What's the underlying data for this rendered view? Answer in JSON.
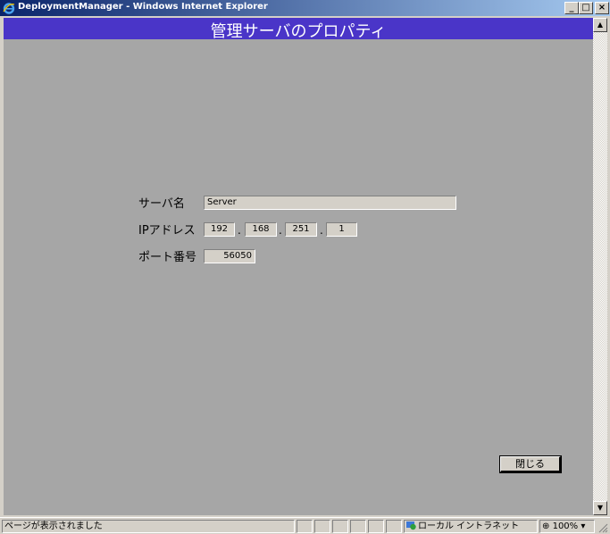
{
  "window": {
    "title": "DeploymentManager - Windows Internet Explorer",
    "minimize": "_",
    "maximize": "□",
    "close": "×"
  },
  "page": {
    "title": "管理サーバのプロパティ"
  },
  "form": {
    "server_name_label": "サーバ名",
    "server_name_value": "Server",
    "ip_label": "IPアドレス",
    "ip_octets": [
      "192",
      "168",
      "251",
      "1"
    ],
    "ip_separator": ".",
    "port_label": "ポート番号",
    "port_value": "56050"
  },
  "close_button_label": "閉じる",
  "scrollbar": {
    "up": "▲",
    "down": "▼"
  },
  "status": {
    "message": "ページが表示されました",
    "zone": "ローカル イントラネット",
    "zoom": "100%",
    "zoom_arrow": "▾"
  },
  "colors": {
    "header_bar": "#4a35c8",
    "page_background": "#a6a6a6",
    "chrome": "#d4d0c8"
  }
}
